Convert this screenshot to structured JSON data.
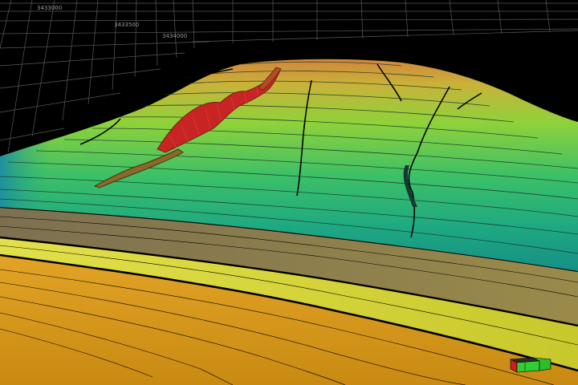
{
  "viewer": {
    "axis_labels": [
      "3433000",
      "3433500",
      "3434000"
    ]
  },
  "colors": {
    "background": "#000000",
    "grid": "#5a5a5a",
    "surface_high": "#d08a3c",
    "surface_mid": "#8fd23a",
    "surface_low": "#1fa78a",
    "fault_fill": "#cc2020",
    "layer_olive": "#8a7a48",
    "layer_yellow": "#d8d83a",
    "layer_orange": "#d99a1c"
  },
  "icons": {
    "orientation_cube": "axis-cube-icon"
  }
}
